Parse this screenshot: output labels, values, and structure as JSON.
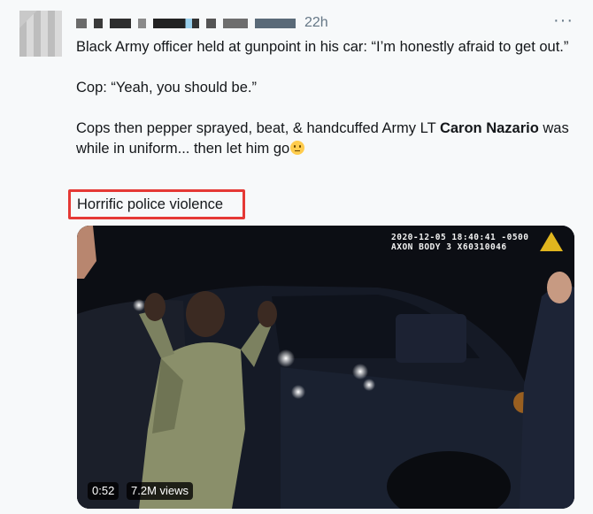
{
  "tweet": {
    "timestamp": "22h",
    "more_label": "···",
    "paragraphs": {
      "p1": "Black Army officer held at gunpoint in his car: “I’m honestly afraid to get out.”",
      "p2": "Cop: “Yeah, you should be.”",
      "p3_before": "Cops then pepper sprayed, beat, & handcuffed Army LT ",
      "p3_bold": "Caron Nazario",
      "p3_after": " was while in uniform... then let him go"
    },
    "highlighted_text": "Horrific police violence"
  },
  "video": {
    "overlay_line1": "2020-12-05 18:40:41 -0500",
    "overlay_line2": "AXON BODY 3 X60310046",
    "duration": "0:52",
    "views": "7.2M views"
  },
  "colors": {
    "highlight_border": "#e53935",
    "text": "#14171a",
    "muted": "#657786"
  }
}
